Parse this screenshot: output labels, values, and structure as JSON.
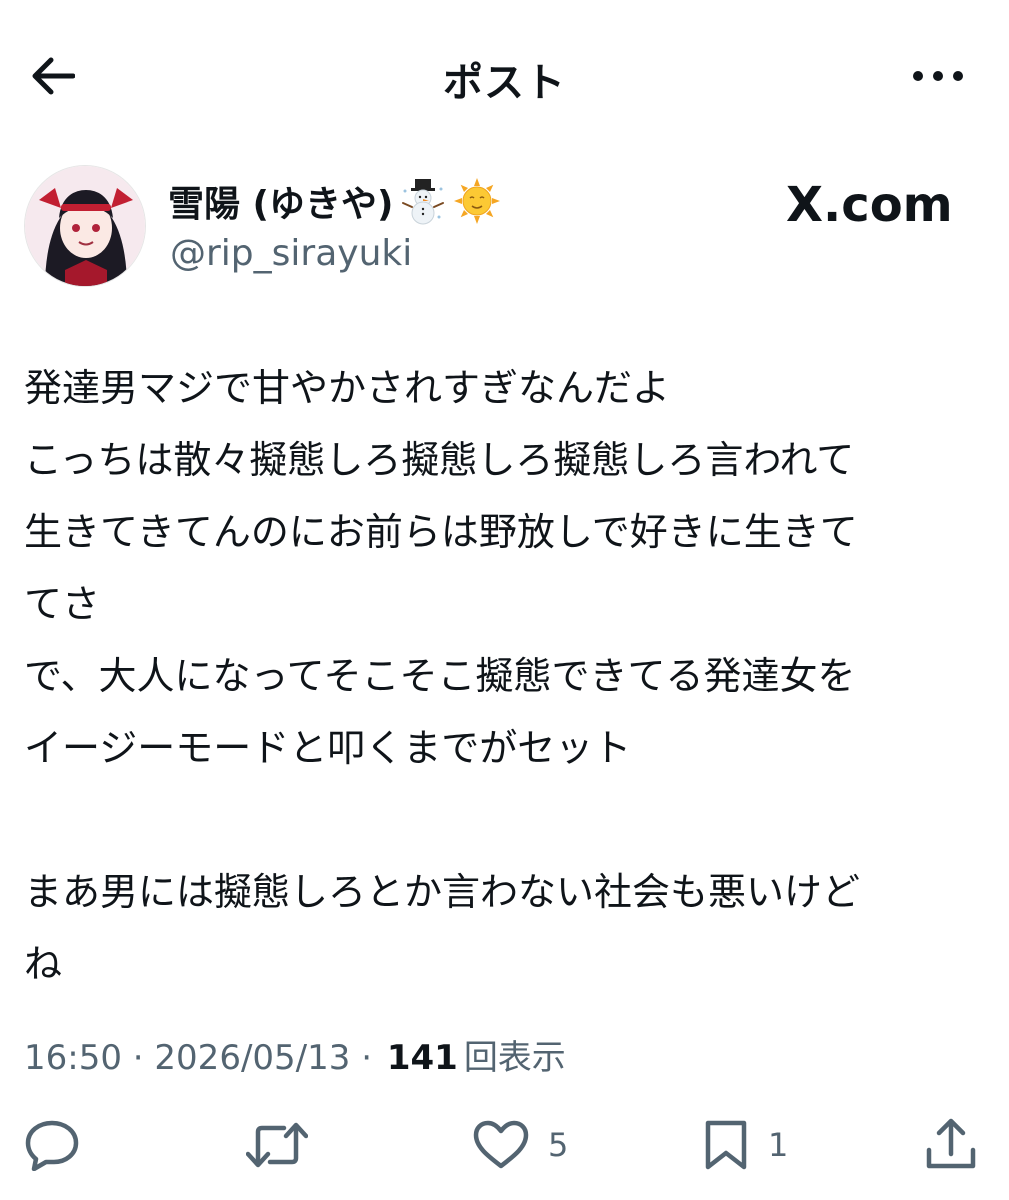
{
  "header": {
    "title": "ポスト",
    "back_icon": "arrow-left-icon",
    "more_icon": "more-horizontal-icon"
  },
  "author": {
    "display_name": "雪陽 (ゆきや)",
    "name_emojis": [
      "snowman-icon",
      "sun-face-icon"
    ],
    "handle": "@rip_sirayuki",
    "watermark": "X.com"
  },
  "tweet": {
    "lines": [
      "発達男マジで甘やかされすぎなんだよ",
      "こっちは散々擬態しろ擬態しろ擬態しろ言われて",
      "生きてきてんのにお前らは野放しで好きに生きて",
      "てさ",
      "で、大人になってそこそこ擬態できてる発達女を",
      "イージーモードと叩くまでがセット",
      "",
      "まあ男には擬態しろとか言わない社会も悪いけど",
      "ね"
    ]
  },
  "meta": {
    "time": "16:50",
    "separator": "·",
    "date": "2026/05/13",
    "views_count": "141",
    "views_label": "回表示"
  },
  "actions": {
    "reply_count": "",
    "retweet_count": "",
    "like_count": "5",
    "bookmark_count": "1"
  },
  "colors": {
    "text": "#0f1419",
    "secondary": "#536471"
  }
}
